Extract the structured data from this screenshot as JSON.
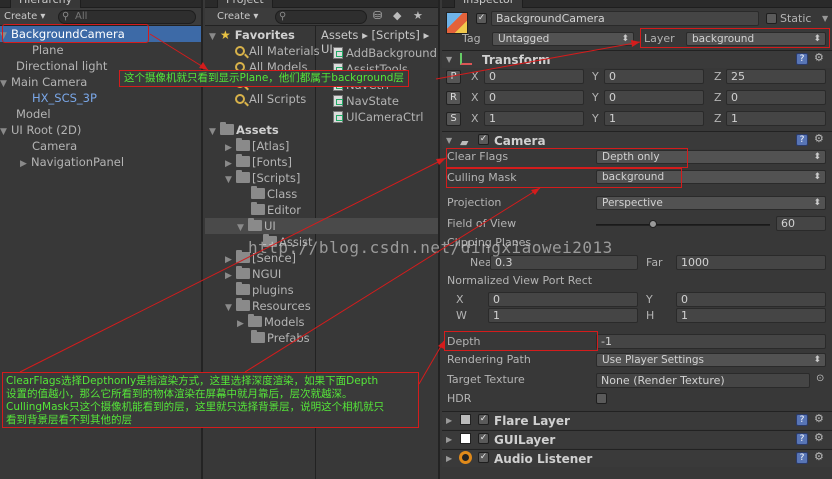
{
  "hierarchy": {
    "tab_label": "Hierarchy",
    "create_label": "Create",
    "search_placeholder": "All",
    "items": [
      {
        "label": "BackgroundCamera",
        "expanded": true,
        "selected": true
      },
      {
        "label": "Plane"
      },
      {
        "label": "Directional light"
      },
      {
        "label": "Main Camera",
        "expanded": true
      },
      {
        "label": "HX_SCS_3P",
        "prefab": true
      },
      {
        "label": "Model"
      },
      {
        "label": "UI Root (2D)",
        "expanded": true
      },
      {
        "label": "Camera"
      },
      {
        "label": "NavigationPanel",
        "collapsed": true
      }
    ]
  },
  "project": {
    "tab_label": "Project",
    "create_label": "Create",
    "breadcrumb": [
      "Assets",
      "[Scripts]",
      "UI"
    ],
    "favorites_label": "Favorites",
    "favorites": [
      "All Materials",
      "All Models",
      "All Prefabs",
      "All Scripts"
    ],
    "assets_label": "Assets",
    "folders": [
      "[Atlas]",
      "[Fonts]",
      "[Scripts]",
      "Class",
      "Editor",
      "UI",
      "Assist",
      "[Sence]",
      "NGUI",
      "plugins",
      "Resources",
      "Models",
      "Prefabs"
    ],
    "files": [
      "AddBackground",
      "AssistTools",
      "NavCtrl",
      "NavState",
      "UICameraCtrl"
    ]
  },
  "inspector": {
    "tab_label": "Inspector",
    "object_name": "BackgroundCamera",
    "static_label": "Static",
    "tag_label": "Tag",
    "tag_value": "Untagged",
    "layer_label": "Layer",
    "layer_value": "background",
    "transform": {
      "title": "Transform",
      "position": {
        "x": "0",
        "y": "0",
        "z": "25"
      },
      "rotation": {
        "x": "0",
        "y": "0",
        "z": "0"
      },
      "scale": {
        "x": "1",
        "y": "1",
        "z": "1"
      }
    },
    "camera": {
      "title": "Camera",
      "clear_flags_label": "Clear Flags",
      "clear_flags_value": "Depth only",
      "culling_mask_label": "Culling Mask",
      "culling_mask_value": "background",
      "projection_label": "Projection",
      "projection_value": "Perspective",
      "fov_label": "Field of View",
      "fov_value": "60",
      "fov_fraction": 0.33,
      "clipping_label": "Clipping Planes",
      "near_label": "Near",
      "near_value": "0.3",
      "far_label": "Far",
      "far_value": "1000",
      "viewport_label": "Normalized View Port Rect",
      "vp_x": "0",
      "vp_y": "0",
      "vp_w": "1",
      "vp_h": "1",
      "depth_label": "Depth",
      "depth_value": "-1",
      "render_path_label": "Rendering Path",
      "render_path_value": "Use Player Settings",
      "target_texture_label": "Target Texture",
      "target_texture_value": "None (Render Texture)",
      "hdr_label": "HDR"
    },
    "flare_layer_title": "Flare Layer",
    "gui_layer_title": "GUILayer",
    "audio_listener_title": "Audio Listener"
  },
  "annotations": {
    "note_top": "这个摄像机就只看到显示Plane，他们都属于background层",
    "note_bottom": [
      "ClearFlags选择Depthonly是指渲染方式，这里选择深度渲染，如果下面Depth",
      "设置的值越小，那么它所看到的物体渲染在屏幕中就月靠后，层次就越深。",
      "CullingMask只这个摄像机能看到的层，这里就只选择背景层，说明这个相机就只",
      "看到背景层看不到其他的层"
    ],
    "watermark": "http://blog.csdn.net/dingxiaowei2013",
    "color": "#d41c1c",
    "text_color": "#55e639"
  },
  "colors": {
    "selection": "#3d6aa7",
    "panel": "#383838",
    "prefab_text": "#7aa7e8"
  }
}
